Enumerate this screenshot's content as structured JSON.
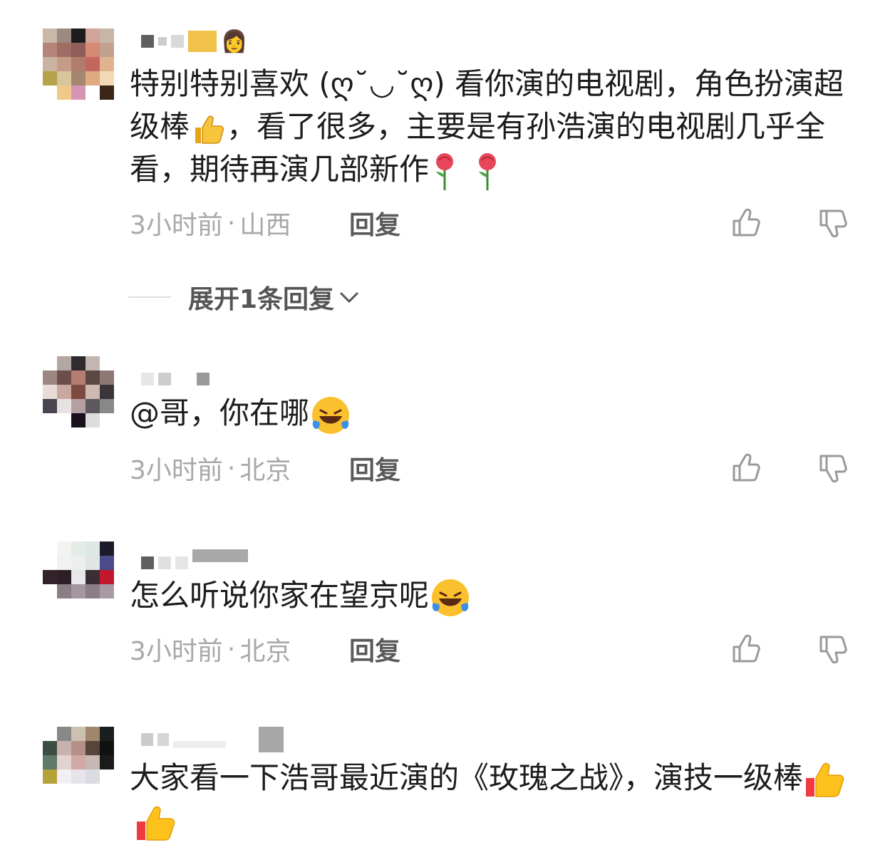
{
  "comments": [
    {
      "text": "特别特别喜欢 (ღ˘◡˘ღ) 看你演的电视剧，角色扮演超级棒",
      "text_b": "，看了很多，主要是有孙浩演的电视剧几乎全看，期待再演几部新作",
      "meta_time": "3小时前",
      "meta_dot": "·",
      "meta_location": "山西",
      "reply_label": "回复",
      "emojis": [
        "thumbs-up-emoji",
        "rose-emoji",
        "rose-emoji"
      ]
    },
    {
      "text": "@哥，你在哪",
      "meta_time": "3小时前",
      "meta_dot": "·",
      "meta_location": "北京",
      "reply_label": "回复",
      "emojis": [
        "rofl-emoji"
      ]
    },
    {
      "text": "怎么听说你家在望京呢",
      "meta_time": "3小时前",
      "meta_dot": "·",
      "meta_location": "北京",
      "reply_label": "回复",
      "emojis": [
        "rofl-emoji"
      ]
    },
    {
      "text": "大家看一下浩哥最近演的《玫瑰之战》，演技一级棒",
      "emojis": [
        "thumbs-up-emoji",
        "thumbs-up-emoji"
      ]
    }
  ],
  "expand_replies": {
    "label": "展开1条回复"
  },
  "icons": {
    "like": "thumbs-up-outline-icon",
    "dislike": "thumbs-down-outline-icon",
    "chevron": "chevron-down-icon"
  }
}
